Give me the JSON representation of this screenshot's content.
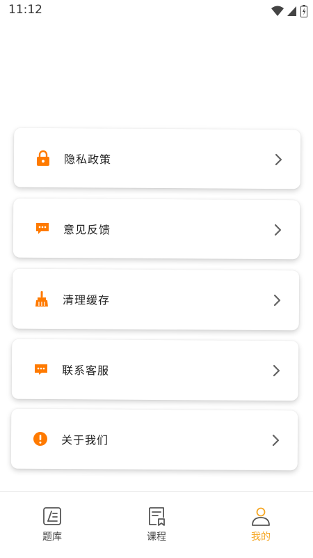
{
  "status_bar": {
    "time": "11:12",
    "icons": [
      "wifi-icon",
      "signal-icon",
      "battery-icon"
    ]
  },
  "colors": {
    "accent": "#FF7A00",
    "active_tab": "#F5A623",
    "chevron": "#666666"
  },
  "menu": {
    "items": [
      {
        "label": "隐私政策",
        "icon": "lock-icon"
      },
      {
        "label": "意见反馈",
        "icon": "chat-bubble-icon"
      },
      {
        "label": "清理缓存",
        "icon": "broom-icon"
      },
      {
        "label": "联系客服",
        "icon": "message-dots-icon"
      },
      {
        "label": "关于我们",
        "icon": "info-exclamation-icon"
      }
    ]
  },
  "tab_bar": {
    "tabs": [
      {
        "label": "题库",
        "icon": "question-bank-icon",
        "active": false
      },
      {
        "label": "课程",
        "icon": "course-icon",
        "active": false
      },
      {
        "label": "我的",
        "icon": "profile-icon",
        "active": true
      }
    ]
  }
}
